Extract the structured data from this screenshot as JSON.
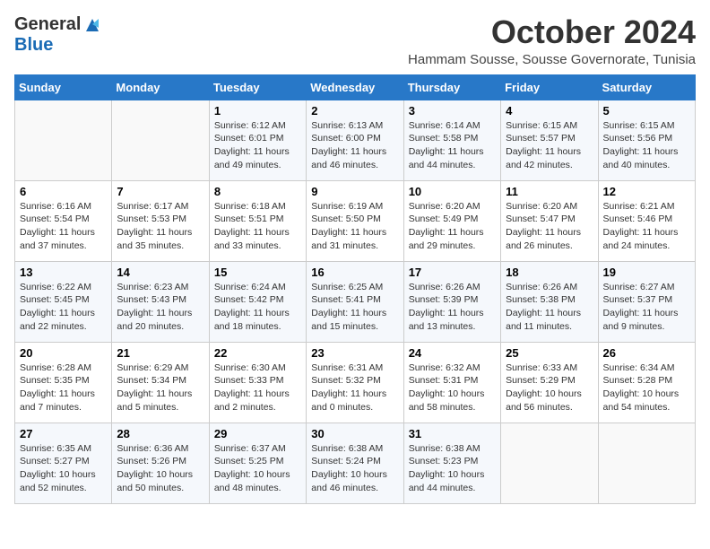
{
  "header": {
    "logo_general": "General",
    "logo_blue": "Blue",
    "month_title": "October 2024",
    "subtitle": "Hammam Sousse, Sousse Governorate, Tunisia"
  },
  "days_of_week": [
    "Sunday",
    "Monday",
    "Tuesday",
    "Wednesday",
    "Thursday",
    "Friday",
    "Saturday"
  ],
  "weeks": [
    [
      {
        "day": "",
        "sunrise": "",
        "sunset": "",
        "daylight": ""
      },
      {
        "day": "",
        "sunrise": "",
        "sunset": "",
        "daylight": ""
      },
      {
        "day": "1",
        "sunrise": "Sunrise: 6:12 AM",
        "sunset": "Sunset: 6:01 PM",
        "daylight": "Daylight: 11 hours and 49 minutes."
      },
      {
        "day": "2",
        "sunrise": "Sunrise: 6:13 AM",
        "sunset": "Sunset: 6:00 PM",
        "daylight": "Daylight: 11 hours and 46 minutes."
      },
      {
        "day": "3",
        "sunrise": "Sunrise: 6:14 AM",
        "sunset": "Sunset: 5:58 PM",
        "daylight": "Daylight: 11 hours and 44 minutes."
      },
      {
        "day": "4",
        "sunrise": "Sunrise: 6:15 AM",
        "sunset": "Sunset: 5:57 PM",
        "daylight": "Daylight: 11 hours and 42 minutes."
      },
      {
        "day": "5",
        "sunrise": "Sunrise: 6:15 AM",
        "sunset": "Sunset: 5:56 PM",
        "daylight": "Daylight: 11 hours and 40 minutes."
      }
    ],
    [
      {
        "day": "6",
        "sunrise": "Sunrise: 6:16 AM",
        "sunset": "Sunset: 5:54 PM",
        "daylight": "Daylight: 11 hours and 37 minutes."
      },
      {
        "day": "7",
        "sunrise": "Sunrise: 6:17 AM",
        "sunset": "Sunset: 5:53 PM",
        "daylight": "Daylight: 11 hours and 35 minutes."
      },
      {
        "day": "8",
        "sunrise": "Sunrise: 6:18 AM",
        "sunset": "Sunset: 5:51 PM",
        "daylight": "Daylight: 11 hours and 33 minutes."
      },
      {
        "day": "9",
        "sunrise": "Sunrise: 6:19 AM",
        "sunset": "Sunset: 5:50 PM",
        "daylight": "Daylight: 11 hours and 31 minutes."
      },
      {
        "day": "10",
        "sunrise": "Sunrise: 6:20 AM",
        "sunset": "Sunset: 5:49 PM",
        "daylight": "Daylight: 11 hours and 29 minutes."
      },
      {
        "day": "11",
        "sunrise": "Sunrise: 6:20 AM",
        "sunset": "Sunset: 5:47 PM",
        "daylight": "Daylight: 11 hours and 26 minutes."
      },
      {
        "day": "12",
        "sunrise": "Sunrise: 6:21 AM",
        "sunset": "Sunset: 5:46 PM",
        "daylight": "Daylight: 11 hours and 24 minutes."
      }
    ],
    [
      {
        "day": "13",
        "sunrise": "Sunrise: 6:22 AM",
        "sunset": "Sunset: 5:45 PM",
        "daylight": "Daylight: 11 hours and 22 minutes."
      },
      {
        "day": "14",
        "sunrise": "Sunrise: 6:23 AM",
        "sunset": "Sunset: 5:43 PM",
        "daylight": "Daylight: 11 hours and 20 minutes."
      },
      {
        "day": "15",
        "sunrise": "Sunrise: 6:24 AM",
        "sunset": "Sunset: 5:42 PM",
        "daylight": "Daylight: 11 hours and 18 minutes."
      },
      {
        "day": "16",
        "sunrise": "Sunrise: 6:25 AM",
        "sunset": "Sunset: 5:41 PM",
        "daylight": "Daylight: 11 hours and 15 minutes."
      },
      {
        "day": "17",
        "sunrise": "Sunrise: 6:26 AM",
        "sunset": "Sunset: 5:39 PM",
        "daylight": "Daylight: 11 hours and 13 minutes."
      },
      {
        "day": "18",
        "sunrise": "Sunrise: 6:26 AM",
        "sunset": "Sunset: 5:38 PM",
        "daylight": "Daylight: 11 hours and 11 minutes."
      },
      {
        "day": "19",
        "sunrise": "Sunrise: 6:27 AM",
        "sunset": "Sunset: 5:37 PM",
        "daylight": "Daylight: 11 hours and 9 minutes."
      }
    ],
    [
      {
        "day": "20",
        "sunrise": "Sunrise: 6:28 AM",
        "sunset": "Sunset: 5:35 PM",
        "daylight": "Daylight: 11 hours and 7 minutes."
      },
      {
        "day": "21",
        "sunrise": "Sunrise: 6:29 AM",
        "sunset": "Sunset: 5:34 PM",
        "daylight": "Daylight: 11 hours and 5 minutes."
      },
      {
        "day": "22",
        "sunrise": "Sunrise: 6:30 AM",
        "sunset": "Sunset: 5:33 PM",
        "daylight": "Daylight: 11 hours and 2 minutes."
      },
      {
        "day": "23",
        "sunrise": "Sunrise: 6:31 AM",
        "sunset": "Sunset: 5:32 PM",
        "daylight": "Daylight: 11 hours and 0 minutes."
      },
      {
        "day": "24",
        "sunrise": "Sunrise: 6:32 AM",
        "sunset": "Sunset: 5:31 PM",
        "daylight": "Daylight: 10 hours and 58 minutes."
      },
      {
        "day": "25",
        "sunrise": "Sunrise: 6:33 AM",
        "sunset": "Sunset: 5:29 PM",
        "daylight": "Daylight: 10 hours and 56 minutes."
      },
      {
        "day": "26",
        "sunrise": "Sunrise: 6:34 AM",
        "sunset": "Sunset: 5:28 PM",
        "daylight": "Daylight: 10 hours and 54 minutes."
      }
    ],
    [
      {
        "day": "27",
        "sunrise": "Sunrise: 6:35 AM",
        "sunset": "Sunset: 5:27 PM",
        "daylight": "Daylight: 10 hours and 52 minutes."
      },
      {
        "day": "28",
        "sunrise": "Sunrise: 6:36 AM",
        "sunset": "Sunset: 5:26 PM",
        "daylight": "Daylight: 10 hours and 50 minutes."
      },
      {
        "day": "29",
        "sunrise": "Sunrise: 6:37 AM",
        "sunset": "Sunset: 5:25 PM",
        "daylight": "Daylight: 10 hours and 48 minutes."
      },
      {
        "day": "30",
        "sunrise": "Sunrise: 6:38 AM",
        "sunset": "Sunset: 5:24 PM",
        "daylight": "Daylight: 10 hours and 46 minutes."
      },
      {
        "day": "31",
        "sunrise": "Sunrise: 6:38 AM",
        "sunset": "Sunset: 5:23 PM",
        "daylight": "Daylight: 10 hours and 44 minutes."
      },
      {
        "day": "",
        "sunrise": "",
        "sunset": "",
        "daylight": ""
      },
      {
        "day": "",
        "sunrise": "",
        "sunset": "",
        "daylight": ""
      }
    ]
  ]
}
